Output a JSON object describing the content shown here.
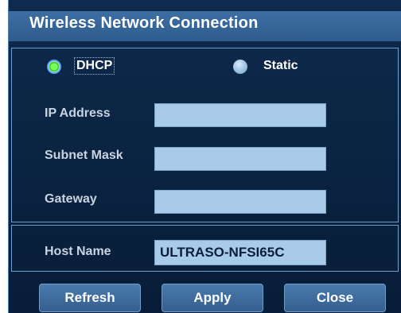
{
  "dialog": {
    "title": "Wireless Network Connection",
    "mode_options": {
      "dhcp_label": "DHCP",
      "static_label": "Static",
      "selected": "DHCP"
    },
    "fields": {
      "ip_label": "IP Address",
      "ip_value": "",
      "subnet_label": "Subnet Mask",
      "subnet_value": "",
      "gateway_label": "Gateway",
      "gateway_value": "",
      "host_label": "Host Name",
      "host_value": "ULTRASO-NFSI65C"
    },
    "buttons": {
      "refresh": "Refresh",
      "apply": "Apply",
      "close": "Close"
    }
  },
  "colors": {
    "background": "#0a2240",
    "titlebar": "#3a6a9e",
    "field": "#a9cbea",
    "radio_selected": "#39d12a"
  },
  "icons": {
    "dhcp_radio": "radio-selected-icon",
    "static_radio": "radio-unselected-icon"
  }
}
